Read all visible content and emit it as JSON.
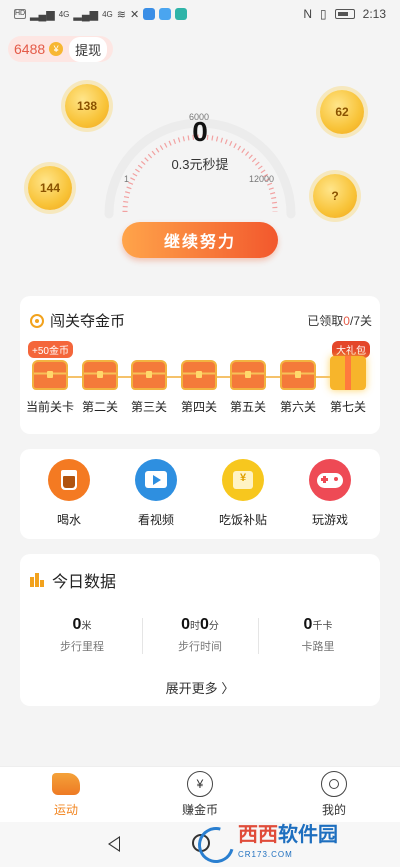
{
  "status_bar": {
    "left_badges": [
      "HD",
      "4G",
      "4G"
    ],
    "time": "2:13"
  },
  "hero": {
    "coin_balance": "6488",
    "yen_symbol": "¥",
    "withdraw_label": "提现",
    "bubbles": [
      "138",
      "62",
      "144",
      "?"
    ],
    "gauge": {
      "current": "0",
      "scale_labels": [
        "1",
        "6000",
        "12000"
      ],
      "subtitle": "0.3元秒提",
      "progress": 0
    },
    "cta_label": "继续努力"
  },
  "levels": {
    "title": "闯关夺金币",
    "claimed_prefix": "已领取",
    "claimed_count": "0",
    "claimed_suffix": "/7关",
    "first_tag": "+50金币",
    "last_tag": "大礼包",
    "items": [
      "当前关卡",
      "第二关",
      "第三关",
      "第四关",
      "第五关",
      "第六关",
      "第七关"
    ]
  },
  "actions": [
    {
      "label": "喝水",
      "icon": "cup-icon",
      "color": "#f47a22"
    },
    {
      "label": "看视频",
      "icon": "tv-icon",
      "color": "#2e8fe0"
    },
    {
      "label": "吃饭补贴",
      "icon": "meal-ticket-icon",
      "color": "#f7c71e"
    },
    {
      "label": "玩游戏",
      "icon": "gamepad-icon",
      "color": "#ee4a55"
    }
  ],
  "today": {
    "title": "今日数据",
    "stats": [
      {
        "value": "0",
        "unit": "米",
        "label": "步行里程"
      },
      {
        "value1": "0",
        "unit1": "时",
        "value2": "0",
        "unit2": "分",
        "label": "步行时间"
      },
      {
        "value": "0",
        "unit": "千卡",
        "label": "卡路里"
      }
    ],
    "more_label": "展开更多",
    "more_arrow": "〉"
  },
  "tabbar": {
    "tabs": [
      {
        "label": "运动",
        "active": true
      },
      {
        "label": "赚金币",
        "active": false,
        "glyph": "¥"
      },
      {
        "label": "我的",
        "active": false
      }
    ]
  },
  "watermark": {
    "name_a": "西西",
    "name_b": "软件园",
    "sub": "CR173.COM"
  }
}
